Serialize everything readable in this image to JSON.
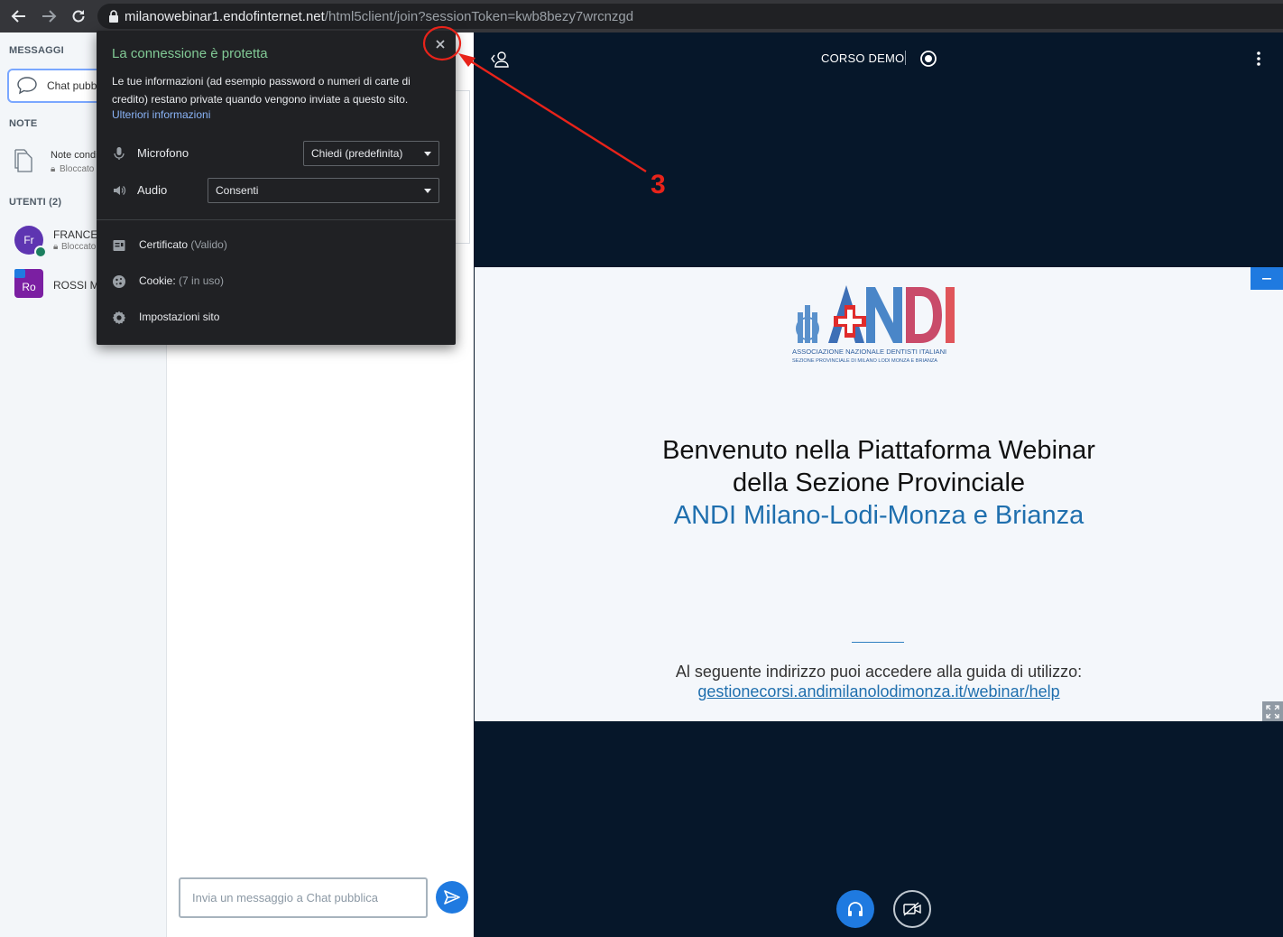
{
  "browser": {
    "url_host": "milanowebinar1.endofinternet.net",
    "url_path": "/html5client/join?sessionToken=kwb8bezy7wrcnzgd"
  },
  "sidebar": {
    "messages_title": "MESSAGGI",
    "public_chat_label": "Chat pubblica",
    "notes_title": "NOTE",
    "shared_notes_label": "Note condivise",
    "shared_notes_sub": "Bloccato",
    "users_title": "UTENTI (2)",
    "users": [
      {
        "initials": "Fr",
        "name": "FRANCESCO",
        "sub": "Bloccato",
        "color": "#5e35b1"
      },
      {
        "initials": "Ro",
        "name": "ROSSI MARIO",
        "sub": "",
        "color": "#7b1fa2"
      }
    ]
  },
  "chat": {
    "input_placeholder": "Invia un messaggio a Chat pubblica"
  },
  "main": {
    "meeting_title": "CORSO DEMO"
  },
  "slide": {
    "logo_text": "ANDI",
    "logo_sub1": "ASSOCIAZIONE NAZIONALE DENTISTI ITALIANI",
    "logo_sub2": "SEZIONE PROVINCIALE DI MILANO LODI MONZA E BRIANZA",
    "heading_line1": "Benvenuto nella Piattaforma Webinar",
    "heading_line2": "della Sezione Provinciale",
    "heading_line3": "ANDI Milano-Lodi-Monza e Brianza",
    "guide_text": "Al seguente indirizzo puoi accedere alla guida di utilizzo:",
    "guide_link": "gestionecorsi.andimilanolodimonza.it/webinar/help"
  },
  "popup": {
    "title": "La connessione è protetta",
    "description": "Le tue informazioni (ad esempio password o numeri di carte di credito) restano private quando vengono inviate a questo sito.",
    "more_info_link": "Ulteriori informazioni",
    "microphone_label": "Microfono",
    "microphone_value": "Chiedi (predefinita)",
    "audio_label": "Audio",
    "audio_value": "Consenti",
    "certificate_label": "Certificato",
    "certificate_status": "(Valido)",
    "cookie_label": "Cookie:",
    "cookie_status": "(7 in uso)",
    "site_settings_label": "Impostazioni sito"
  },
  "annotation": {
    "number": "3",
    "color": "#e8231a"
  }
}
